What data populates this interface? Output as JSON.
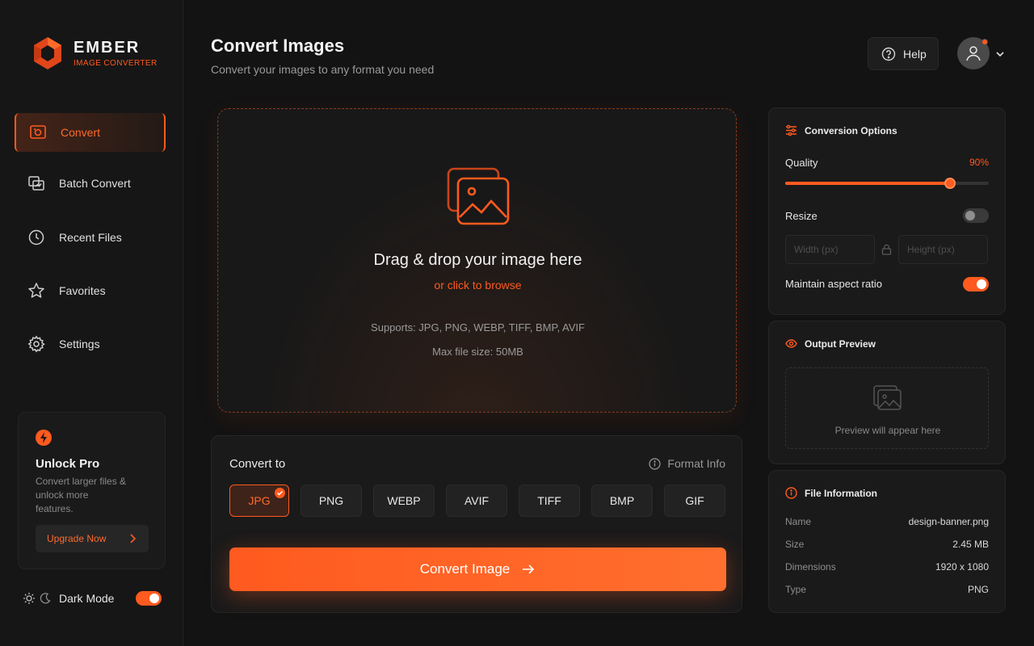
{
  "app": {
    "name": "EMBER",
    "subtitle": "IMAGE CONVERTER"
  },
  "sidebar": {
    "items": [
      {
        "label": "Convert",
        "icon": "convert-icon",
        "active": true
      },
      {
        "label": "Batch Convert",
        "icon": "batch-icon",
        "active": false
      },
      {
        "label": "Recent Files",
        "icon": "clock-icon",
        "active": false
      },
      {
        "label": "Favorites",
        "icon": "star-icon",
        "active": false
      },
      {
        "label": "Settings",
        "icon": "gear-icon",
        "active": false
      }
    ],
    "pro": {
      "title": "Unlock Pro",
      "description": "Convert larger files & unlock more features.",
      "button": "Upgrade Now"
    },
    "dark_mode_label": "Dark Mode",
    "dark_mode_on": true
  },
  "header": {
    "title": "Convert Images",
    "subtitle": "Convert your images to any format you need",
    "help_label": "Help"
  },
  "dropzone": {
    "title": "Drag & drop your image here",
    "browse": "or click to browse",
    "supports": "Supports: JPG, PNG, WEBP, TIFF, BMP, AVIF",
    "max_size": "Max file size: 50MB"
  },
  "convert": {
    "title": "Convert to",
    "format_info": "Format Info",
    "formats": [
      "JPG",
      "PNG",
      "WEBP",
      "AVIF",
      "TIFF",
      "BMP",
      "GIF"
    ],
    "selected": "JPG",
    "button": "Convert Image"
  },
  "options": {
    "title": "Conversion Options",
    "quality_label": "Quality",
    "quality_display": "90%",
    "quality_level": 0.81,
    "resize_label": "Resize",
    "resize_on": false,
    "width_placeholder": "Width (px)",
    "height_placeholder": "Height (px)",
    "aspect_label": "Maintain aspect ratio",
    "aspect_on": true
  },
  "preview": {
    "title": "Output Preview",
    "placeholder": "Preview will appear here"
  },
  "file_info": {
    "title": "File Information",
    "rows": [
      {
        "key": "Name",
        "value": "design-banner.png"
      },
      {
        "key": "Size",
        "value": "2.45 MB"
      },
      {
        "key": "Dimensions",
        "value": "1920 x 1080"
      },
      {
        "key": "Type",
        "value": "PNG"
      }
    ]
  },
  "colors": {
    "accent": "#ff5a1f",
    "background": "#131313",
    "panel": "#1a1a1a"
  }
}
